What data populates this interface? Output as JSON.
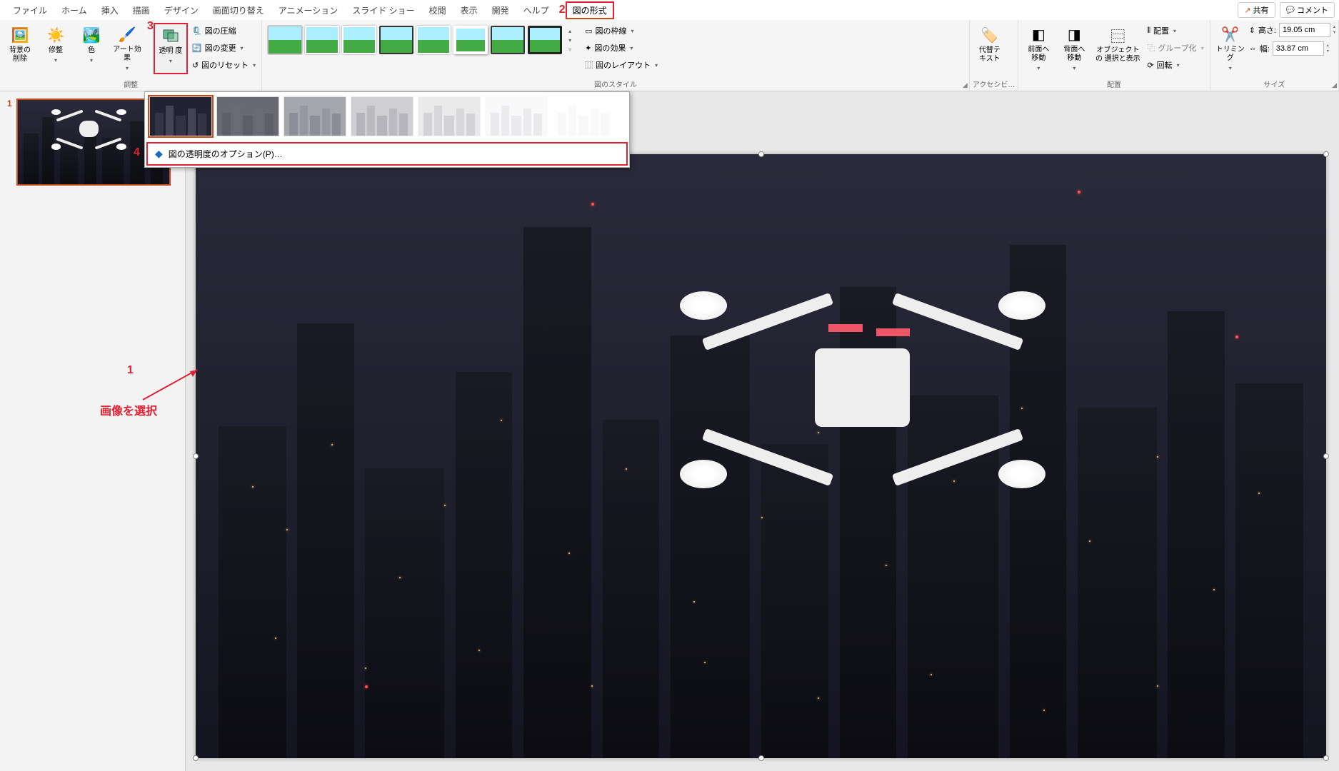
{
  "menubar": {
    "items": [
      "ファイル",
      "ホーム",
      "挿入",
      "描画",
      "デザイン",
      "画面切り替え",
      "アニメーション",
      "スライド ショー",
      "校閲",
      "表示",
      "開発",
      "ヘルプ",
      "図の形式"
    ],
    "active_index": 12,
    "share": "共有",
    "comment": "コメント"
  },
  "ribbon": {
    "adjust": {
      "label": "調整",
      "remove_bg": "背景の\n削除",
      "corrections": "修整",
      "color": "色",
      "artistic": "アート効果",
      "transparency": "透明\n度",
      "compress": "図の圧縮",
      "change": "図の変更",
      "reset": "図のリセット"
    },
    "styles": {
      "label": "図のスタイル",
      "border": "図の枠線",
      "effects": "図の効果",
      "layout": "図のレイアウト"
    },
    "accessibility": {
      "label": "アクセシビ…",
      "alt_text": "代替テ\nキスト"
    },
    "arrange": {
      "label": "配置",
      "bring_forward": "前面へ\n移動",
      "send_backward": "背面へ\n移動",
      "selection_pane": "オブジェクトの\n選択と表示",
      "align": "配置",
      "group": "グループ化",
      "rotate": "回転"
    },
    "size": {
      "label": "サイズ",
      "crop": "トリミング",
      "height_label": "高さ:",
      "width_label": "幅:",
      "height_value": "19.05 cm",
      "width_value": "33.87 cm"
    }
  },
  "transparency_menu": {
    "options_label": "図の透明度のオプション(P)…",
    "preset_count": 7
  },
  "slide_panel": {
    "slide_number": "1"
  },
  "annotations": {
    "n1": "1",
    "n2": "2",
    "n3": "3",
    "n4": "4",
    "select_image": "画像を選択"
  }
}
